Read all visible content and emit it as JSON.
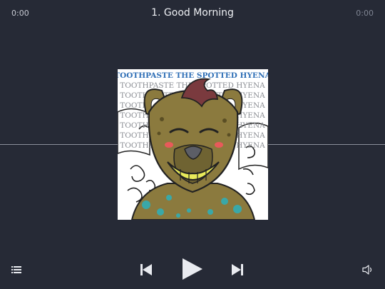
{
  "player": {
    "elapsed": "0:00",
    "duration": "0:00",
    "track_title": "1. Good Morning"
  },
  "album_art": {
    "title_line": "TOOTHPASTE THE SPOTTED HYENA",
    "repeat_line": "TOOTHPASTE THE SPOTTED HYENA"
  },
  "progress": 0,
  "colors": {
    "background": "#262a36",
    "text": "#e9ebf0",
    "title_blue": "#2f6fb6"
  },
  "icons": {
    "playlist": "list-icon",
    "previous": "skip-previous-icon",
    "play": "play-icon",
    "next": "skip-next-icon",
    "volume": "speaker-icon"
  }
}
